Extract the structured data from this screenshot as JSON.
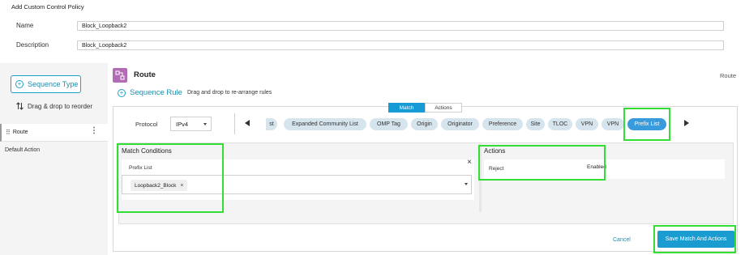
{
  "header": {
    "title": "Add Custom Control Policy",
    "name_label": "Name",
    "name_value": "Block_Loopback2",
    "description_label": "Description",
    "description_value": "Block_Loopback2"
  },
  "sidebar": {
    "sequence_type_label": "Sequence Type",
    "drag_reorder_label": "Drag & drop to reorder",
    "items": [
      {
        "label": "Route"
      }
    ],
    "default_action_label": "Default Action"
  },
  "main": {
    "title": "Route",
    "title_right": "Route",
    "sequence_rule_label": "Sequence Rule",
    "sequence_rule_hint": "Drag and drop to re-arrange rules",
    "toggle": {
      "match_label": "Match",
      "actions_label": "Actions"
    },
    "protocol_label": "Protocol",
    "protocol_value": "IPv4",
    "chips": [
      {
        "label": "st"
      },
      {
        "label": "Expanded Community List"
      },
      {
        "label": "OMP Tag"
      },
      {
        "label": "Origin"
      },
      {
        "label": "Originator"
      },
      {
        "label": "Preference"
      },
      {
        "label": "Site"
      },
      {
        "label": "TLOC"
      },
      {
        "label": "VPN"
      },
      {
        "label": "VPN"
      },
      {
        "label": "Prefix List"
      }
    ],
    "match_conditions": {
      "title": "Match Conditions",
      "field_label": "Prefix List",
      "tag_value": "Loopback2_Block"
    },
    "actions": {
      "title": "Actions",
      "label": "Reject",
      "value": "Enabled"
    },
    "cancel_label": "Cancel",
    "save_label": "Save Match And Actions"
  },
  "colors": {
    "accent": "#1a9cd0",
    "highlight": "#33dd33",
    "chip": "#d6e4ee",
    "chip_active": "#3a9bdc",
    "route_icon": "#b26bb4"
  }
}
